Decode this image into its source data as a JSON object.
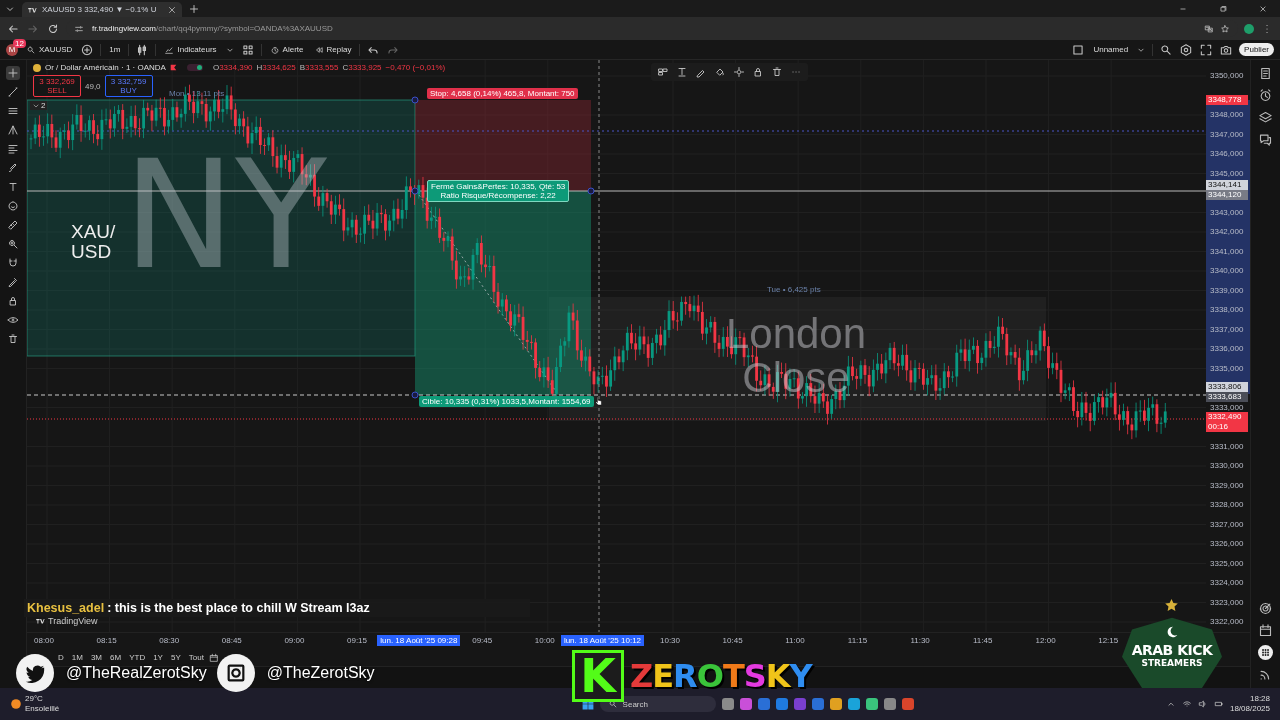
{
  "browser": {
    "tab_title": "XAUUSD 3 332,490 ▼ −0.1% U",
    "url_host": "fr.tradingview.com",
    "url_path": "/chart/qq4pymmy/?symbol=OANDA%3AXAUUSD"
  },
  "toolbar": {
    "avatar": "M",
    "notifications": "12",
    "symbol": "XAUUSD",
    "interval": "1m",
    "indicators": "Indicateurs",
    "alert": "Alerte",
    "replay": "Replay",
    "layout_name": "Unnamed",
    "publish": "Publier"
  },
  "left_tools": [
    {
      "selected": true
    },
    {
      "selected": false
    },
    {
      "selected": false
    },
    {
      "selected": false
    },
    {
      "selected": false
    },
    {
      "selected": false
    },
    {
      "selected": false
    },
    {
      "selected": false
    },
    {
      "selected": false
    },
    {
      "selected": false
    },
    {
      "selected": false
    },
    {
      "selected": false
    },
    {
      "selected": false
    },
    {
      "selected": false
    },
    {
      "selected": false
    }
  ],
  "legend": {
    "title": "Or / Dollar Américain · 1 · OANDA",
    "ohlc": [
      {
        "label": "O",
        "value": "3334,390"
      },
      {
        "label": "H",
        "value": "3334,625"
      },
      {
        "label": "B",
        "value": "3333,555"
      },
      {
        "label": "C",
        "value": "3333,925"
      }
    ],
    "change": "−0,470 (−0,01%)",
    "trading_toggle_on": true,
    "sell_price": "3 332,269",
    "sell": "SELL",
    "spread": "49,0",
    "buy_price": "3 332,759",
    "buy": "BUY",
    "collapsed_count": "2"
  },
  "drawings": {
    "range_label": "Mon • 13,11 pts",
    "stop_label": "Stop: 4,658 (0,14%) 465,8, Montant: 750",
    "pnl_lines": [
      "Fermé Gains&Pertes: 10,335, Qté: 53",
      "Ratio Risque/Récompense: 2,22"
    ],
    "target_label": "Cible: 10,335 (0,31%) 1033,5,Montant: 1554,69",
    "session_label": "Tue • 6,425 pts",
    "session_text": "NY",
    "symbol_lines": [
      "XAU/",
      "USD"
    ],
    "london_text": "London Close",
    "brand": "TradingView"
  },
  "price_axis": {
    "ticks": [
      "3350,000",
      "3348,000",
      "3347,000",
      "3346,000",
      "3345,000",
      "3343,000",
      "3342,000",
      "3341,000",
      "3340,000",
      "3339,000",
      "3338,000",
      "3337,000",
      "3336,000",
      "3335,000",
      "3333,000",
      "3331,000",
      "3330,000",
      "3329,000",
      "3328,000",
      "3327,000",
      "3326,000",
      "3325,000",
      "3324,000",
      "3323,000",
      "3322,000"
    ],
    "tags": [
      {
        "text": "3348,778",
        "color": "#f23645"
      },
      {
        "text": "3344,141",
        "color": "#d1d4dc"
      },
      {
        "text": "3344,120",
        "color": "#787b86"
      },
      {
        "text": "3333,806",
        "color": "#d1d4dc"
      },
      {
        "text": "3333,683",
        "color": "#4a4d57"
      },
      {
        "text": "3332,490",
        "color": "#f23645"
      }
    ],
    "countdown": "00:16"
  },
  "time_axis": {
    "ticks": [
      "08:00",
      "08:15",
      "08:30",
      "08:45",
      "09:00",
      "09:15",
      "09:45",
      "10:00",
      "10:30",
      "10:45",
      "11:00",
      "11:15",
      "11:30",
      "11:45",
      "12:00",
      "12:15"
    ],
    "cursor_labels": [
      "lun. 18 Août '25 09:28",
      "lun. 18 Août '25 10:12"
    ]
  },
  "ranges": [
    "D",
    "1M",
    "3M",
    "6M",
    "YTD",
    "1Y",
    "5Y",
    "Tout"
  ],
  "chat": {
    "user": "Khesus_adel",
    "message": ": this is the best place to chill W Stream l3az"
  },
  "socials": [
    {
      "kind": "twitter",
      "handle": "@TheRealZerotSky"
    },
    {
      "kind": "instagram",
      "handle": "@TheZerotSky"
    }
  ],
  "stream_logo": {
    "letter": "K",
    "name": "ZEROTSKY"
  },
  "badge": {
    "line1": "ARAB KICK",
    "line2": "STREAMERS"
  },
  "taskbar": {
    "temperature": "29°C",
    "weather": "Ensoleillé",
    "search": "Search",
    "time": "18:28",
    "date": "18/08/2025"
  }
}
